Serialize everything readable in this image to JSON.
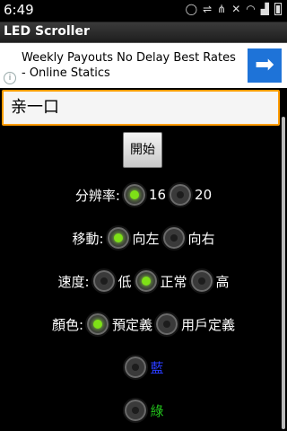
{
  "status_bar": {
    "time": "6:49",
    "icons": [
      "chat-icon",
      "usb-icon",
      "usb-debug-icon",
      "mute-icon",
      "wifi-icon",
      "signal-icon",
      "battery-icon"
    ]
  },
  "app": {
    "title": "LED Scroller"
  },
  "ad": {
    "text": "Weekly Payouts No Delay Best Rates - Online Statics",
    "arrow": "➡",
    "info": "i"
  },
  "input": {
    "value": "亲一口"
  },
  "start_button": {
    "label": "開始"
  },
  "resolution": {
    "label": "分辨率:",
    "options": [
      "16",
      "20"
    ],
    "selected": 0
  },
  "direction": {
    "label": "移動:",
    "options": [
      "向左",
      "向右"
    ],
    "selected": 0
  },
  "speed": {
    "label": "速度:",
    "options": [
      "低",
      "正常",
      "高"
    ],
    "selected": 1
  },
  "color": {
    "label": "顏色:",
    "options": [
      "預定義",
      "用戶定義"
    ],
    "selected": 0
  },
  "color_choices": [
    {
      "label": "藍",
      "color": "#2a3cff"
    },
    {
      "label": "綠",
      "color": "#22c11b"
    }
  ],
  "colors": {
    "accent": "#7ee017",
    "input_focus": "#ff9c00",
    "ad_button": "#1e73d8"
  }
}
